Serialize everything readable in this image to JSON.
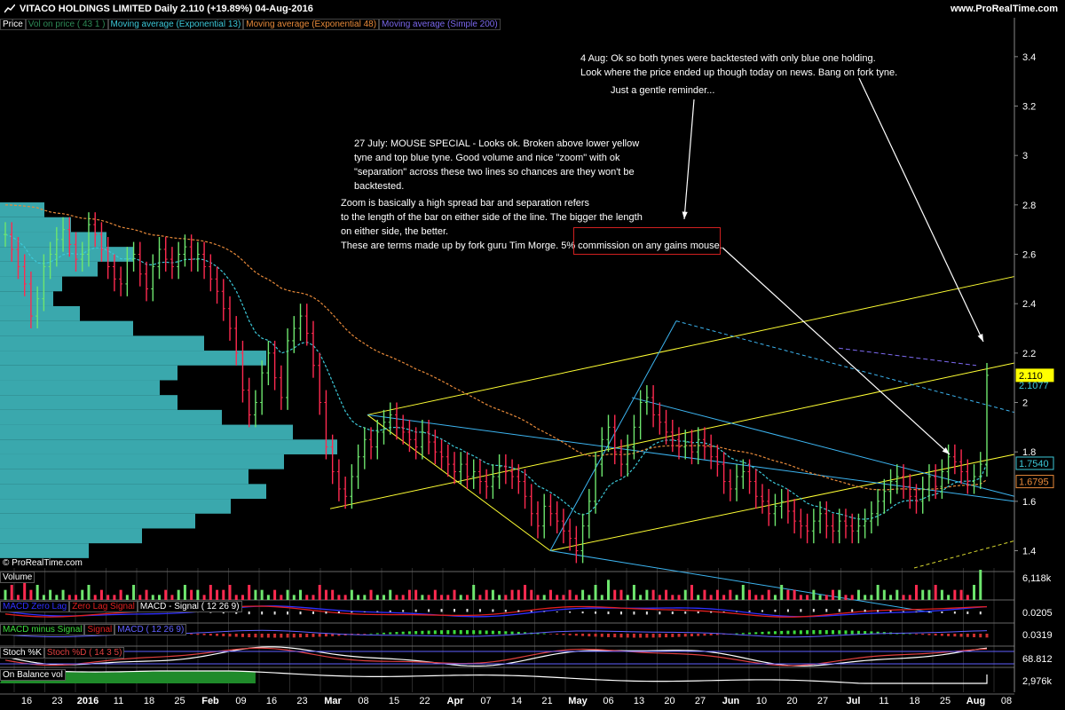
{
  "header": {
    "title": "VITACO HOLDINGS LIMITED   Daily   2.110 (+19.89%)   04-Aug-2016",
    "site": "www.ProRealTime.com",
    "copyright": "© ProRealTime.com"
  },
  "legend": [
    {
      "label": "Price",
      "color": "#ffffff"
    },
    {
      "label": "Vol on price ( 43 1 )",
      "color": "#2e8b57"
    },
    {
      "label": "Moving average (Exponential 13)",
      "color": "#3cc8d8"
    },
    {
      "label": "Moving average (Exponential 48)",
      "color": "#e88a3a"
    },
    {
      "label": "Moving average (Simple 200)",
      "color": "#7b68ee"
    }
  ],
  "annotations": {
    "aug4": "4 Aug: Ok so both tynes were backtested with only blue one holding.\nLook where the price ended up though today on news. Bang on fork tyne.",
    "reminder": "Just a gentle reminder...",
    "july27": "27 July: MOUSE SPECIAL - Looks ok. Broken above lower yellow\ntyne and top blue tyne. Good volume and nice \"zoom\" with ok\n\"separation\" across these two lines so chances are they won't be\nbacktested.",
    "zoom": "Zoom is basically a high spread bar and separation refers\nto the length of the bar on either side of the line. The bigger the length\non either side, the better.\nThese are terms made up by fork guru Tim Morge. 5% commission on any gains mouse."
  },
  "panels": {
    "volume": {
      "label": "Volume",
      "value": "6,118k"
    },
    "macd1": {
      "labels": [
        "MACD Zero Lag",
        "Zero Lag Signal",
        "MACD - Signal ( 12 26 9)"
      ],
      "value": "0.0205"
    },
    "macd2": {
      "labels": [
        "MACD minus Signal",
        "Signal",
        "MACD ( 12 26 9)"
      ],
      "value": "0.0319"
    },
    "stoch": {
      "labels": [
        "Stoch %K",
        "Stoch %D ( 14 3 5)"
      ],
      "value": "68.812"
    },
    "obv": {
      "label": "On Balance vol",
      "value": "2,976k"
    }
  },
  "chart_data": {
    "type": "candlestick",
    "ylim": [
      1.33,
      3.5
    ],
    "yticks": [
      1.4,
      1.6,
      1.8,
      2,
      2.2,
      2.4,
      2.6,
      2.8,
      3,
      3.2,
      3.4
    ],
    "xticks": [
      "16",
      "23",
      "2016",
      "11",
      "18",
      "25",
      "Feb",
      "09",
      "16",
      "23",
      "Mar",
      "08",
      "15",
      "22",
      "Apr",
      "07",
      "14",
      "21",
      "May",
      "06",
      "13",
      "20",
      "27",
      "Jun",
      "10",
      "20",
      "27",
      "Jul",
      "11",
      "18",
      "25",
      "Aug",
      "08"
    ],
    "price_tags": [
      {
        "value": "2.110",
        "style": "box",
        "color": "#ffff00"
      },
      {
        "value": "2.1077",
        "style": "text",
        "color": "#3cc8d8"
      },
      {
        "value": "1.7540",
        "style": "box",
        "color": "#3cc8d8"
      },
      {
        "value": "1.6795",
        "style": "box",
        "color": "#e88a3a"
      }
    ],
    "close": [
      2.68,
      2.62,
      2.55,
      2.48,
      2.35,
      2.42,
      2.55,
      2.6,
      2.66,
      2.7,
      2.64,
      2.58,
      2.6,
      2.72,
      2.68,
      2.62,
      2.55,
      2.5,
      2.48,
      2.58,
      2.6,
      2.52,
      2.46,
      2.55,
      2.62,
      2.58,
      2.55,
      2.6,
      2.63,
      2.58,
      2.6,
      2.55,
      2.5,
      2.45,
      2.38,
      2.3,
      2.2,
      2.05,
      1.95,
      2.0,
      2.12,
      2.2,
      2.1,
      2.02,
      2.25,
      2.3,
      2.35,
      2.28,
      2.15,
      2.0,
      1.82,
      1.72,
      1.65,
      1.62,
      1.7,
      1.78,
      1.85,
      1.82,
      1.88,
      1.92,
      1.95,
      1.9,
      1.88,
      1.85,
      1.82,
      1.88,
      1.84,
      1.8,
      1.78,
      1.75,
      1.72,
      1.75,
      1.7,
      1.72,
      1.68,
      1.66,
      1.7,
      1.74,
      1.72,
      1.7,
      1.68,
      1.62,
      1.55,
      1.5,
      1.58,
      1.55,
      1.52,
      1.48,
      1.45,
      1.4,
      1.5,
      1.6,
      1.75,
      1.85,
      1.9,
      1.8,
      1.75,
      1.82,
      1.9,
      2.0,
      2.02,
      1.95,
      1.92,
      1.88,
      1.85,
      1.82,
      1.84,
      1.8,
      1.85,
      1.82,
      1.78,
      1.75,
      1.68,
      1.65,
      1.7,
      1.72,
      1.68,
      1.62,
      1.6,
      1.55,
      1.58,
      1.6,
      1.56,
      1.52,
      1.5,
      1.48,
      1.52,
      1.55,
      1.5,
      1.48,
      1.52,
      1.5,
      1.48,
      1.5,
      1.52,
      1.55,
      1.6,
      1.64,
      1.68,
      1.7,
      1.66,
      1.62,
      1.6,
      1.65,
      1.7,
      1.66,
      1.72,
      1.78,
      1.76,
      1.72,
      1.68,
      1.7,
      1.75,
      2.11
    ],
    "volume": [
      2,
      3,
      1,
      4,
      2,
      3,
      1,
      2,
      1,
      2,
      1,
      1,
      2,
      3,
      1,
      2,
      1,
      1,
      2,
      1,
      3,
      1,
      2,
      1,
      1,
      2,
      1,
      2,
      3,
      2,
      2,
      1,
      3,
      2,
      2,
      3,
      1,
      1,
      3,
      2,
      2,
      1,
      2,
      1,
      2,
      1,
      2,
      1,
      1,
      3,
      2,
      2,
      1,
      1,
      2,
      1,
      1,
      2,
      1,
      1,
      2,
      1,
      1,
      2,
      2,
      1,
      1,
      2,
      1,
      1,
      2,
      1,
      1,
      3,
      1,
      2,
      2,
      1,
      1,
      2,
      2,
      3,
      2,
      1,
      1,
      2,
      1,
      1,
      2,
      1,
      2,
      1,
      3,
      1,
      4,
      2,
      2,
      1,
      3,
      1,
      2,
      2,
      1,
      2,
      1,
      1,
      2,
      3,
      1,
      2,
      1,
      2,
      1,
      2,
      1,
      3,
      2,
      1,
      1,
      2,
      1,
      3,
      2,
      2,
      1,
      1,
      2,
      1,
      1,
      2,
      2,
      1,
      1,
      2,
      1,
      1,
      3,
      2,
      1,
      2,
      1,
      1,
      3,
      2,
      2,
      3,
      2,
      1,
      2,
      2,
      1,
      3,
      6
    ]
  }
}
